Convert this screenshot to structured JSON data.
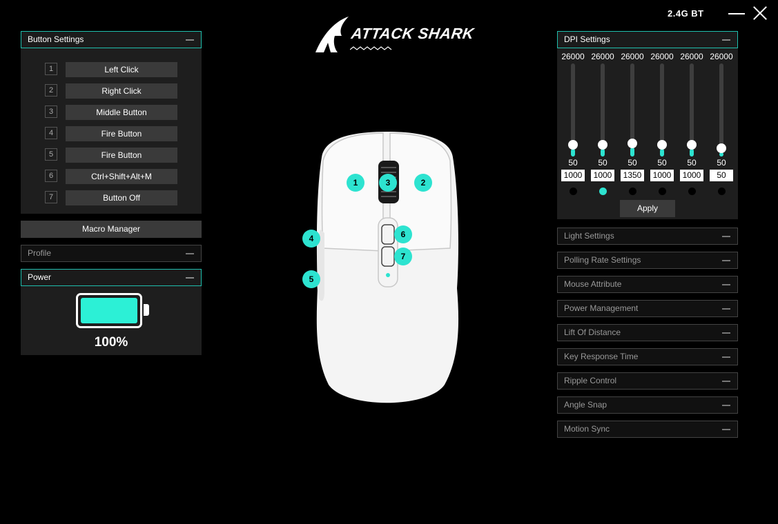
{
  "topbar": {
    "connection": "2.4G  BT"
  },
  "brand": {
    "name": "ATTACK SHARK"
  },
  "button_settings": {
    "title": "Button Settings",
    "rows": [
      {
        "num": "1",
        "label": "Left Click"
      },
      {
        "num": "2",
        "label": "Right Click"
      },
      {
        "num": "3",
        "label": "Middle Button"
      },
      {
        "num": "4",
        "label": "Fire Button"
      },
      {
        "num": "5",
        "label": "Fire Button"
      },
      {
        "num": "6",
        "label": "Ctrl+Shift+Alt+M"
      },
      {
        "num": "7",
        "label": "Button Off"
      }
    ]
  },
  "macro_manager": "Macro Manager",
  "profile": {
    "title": "Profile"
  },
  "power": {
    "title": "Power",
    "battery_percent": 100,
    "battery_label": "100%"
  },
  "mouse_markers": [
    "1",
    "2",
    "3",
    "4",
    "5",
    "6",
    "7"
  ],
  "dpi": {
    "title": "DPI Settings",
    "max_labels": [
      "26000",
      "26000",
      "26000",
      "26000",
      "26000",
      "26000"
    ],
    "min_labels": [
      "50",
      "50",
      "50",
      "50",
      "50",
      "50"
    ],
    "values": [
      "1000",
      "1000",
      "1350",
      "1000",
      "1000",
      "50"
    ],
    "active_index": 1,
    "apply_label": "Apply"
  },
  "settings_sections": [
    "Light Settings",
    "Polling Rate Settings",
    "Mouse Attribute",
    "Power Management",
    "Lift Of Distance",
    "Key Response Time",
    "Ripple Control",
    "Angle Snap",
    "Motion Sync"
  ],
  "colors": {
    "accent": "#2de3d0",
    "panel": "#1e1e1e",
    "button": "#3a3a3a",
    "border": "#1fbfae"
  }
}
